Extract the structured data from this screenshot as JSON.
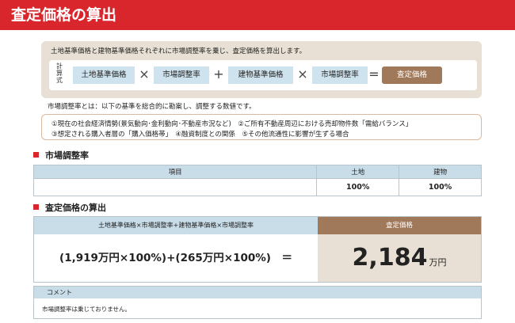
{
  "header": {
    "title": "査定価格の算出"
  },
  "formula": {
    "description": "土地基準価格と建物基準価格それぞれに市場調整率を乗じ、査定価格を算出します。",
    "calc_label": [
      "計",
      "算",
      "式"
    ],
    "terms": {
      "land_base": "土地基準価格",
      "rate1": "市場調整率",
      "building_base": "建物基準価格",
      "rate2": "市場調整率"
    },
    "ops": {
      "times": "×",
      "plus": "+",
      "equals": "="
    },
    "result": "査定価格"
  },
  "definition": "市場調整率とは：以下の基準を総合的に勘案し、調整する数値です。",
  "factors": {
    "line1": "①現在の社会経済情勢(景気動向･金利動向･不動産市況など)　②ご所有不動産周辺における売却物件数「需給バランス」",
    "line2": "③想定される購入者層の「購入価格帯」　④融資制度との関係　⑤その他流通性に影響が生ずる場合"
  },
  "rate_section": {
    "title": "市場調整率",
    "headers": {
      "item": "項目",
      "land": "土地",
      "building": "建物"
    },
    "values": {
      "item": "",
      "land": "100%",
      "building": "100%"
    }
  },
  "calc_section": {
    "title": "査定価格の算出",
    "formula_header": "土地基準価格×市場調整率+建物基準価格×市場調整率",
    "result_header": "査定価格",
    "expression": "(1,919万円×100%)+(265万円×100%)　＝",
    "result_value": "2,184",
    "result_unit": "万円"
  },
  "comment": {
    "title": "コメント",
    "body": "市場調整率は乗じておりません。"
  },
  "colors": {
    "red": "#d9262c",
    "blue": "#cfe3ee",
    "brown": "#a0785a",
    "beige": "#e8e0d4"
  }
}
